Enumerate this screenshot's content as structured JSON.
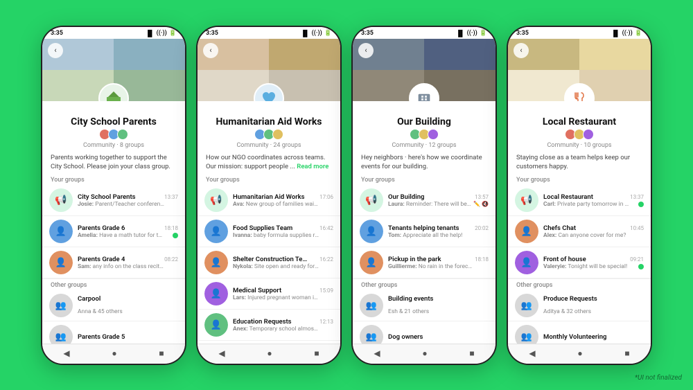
{
  "phones": [
    {
      "id": "phone1",
      "status_time": "3:35",
      "community_name": "City School Parents",
      "community_meta": "Community · 8 groups",
      "community_desc": "Parents working together to support the City School. Please join your class group.",
      "community_icon_type": "school",
      "avatar_colors": [
        "av1",
        "av2",
        "av3"
      ],
      "your_groups_label": "Your groups",
      "groups": [
        {
          "name": "City School Parents",
          "preview_sender": "Josie:",
          "preview": "Parent/Teacher conferences ...",
          "time": "13:37",
          "has_dot": false,
          "avatar_type": "megaphone",
          "avatar_color": "green"
        },
        {
          "name": "Parents Grade 6",
          "preview_sender": "Amelia:",
          "preview": "Have a math tutor for the upc...",
          "time": "18:18",
          "has_dot": true,
          "avatar_type": "person",
          "avatar_color": "blue"
        },
        {
          "name": "Parents Grade 4",
          "preview_sender": "Sam:",
          "preview": "any info on the class recital?",
          "time": "08:22",
          "has_dot": false,
          "avatar_type": "person",
          "avatar_color": "orange"
        }
      ],
      "other_groups_label": "Other groups",
      "other_groups": [
        {
          "name": "Carpool",
          "meta": "Anna & 45 others",
          "avatar_color": "grey"
        },
        {
          "name": "Parents Grade 5",
          "meta": "",
          "avatar_color": "grey"
        }
      ]
    },
    {
      "id": "phone2",
      "status_time": "3:35",
      "community_name": "Humanitarian Aid Works",
      "community_meta": "Community · 24 groups",
      "community_desc": "How our NGO coordinates across teams. Our mission: support people ...",
      "community_desc_read_more": "Read more",
      "community_icon_type": "heart",
      "avatar_colors": [
        "av2",
        "av3",
        "av4"
      ],
      "your_groups_label": "Your groups",
      "groups": [
        {
          "name": "Humanitarian Aid Works",
          "preview_sender": "Ava:",
          "preview": "New group of families waiting ...",
          "time": "17:06",
          "has_dot": false,
          "avatar_type": "megaphone",
          "avatar_color": "green"
        },
        {
          "name": "Food Supplies Team",
          "preview_sender": "Ivanna:",
          "preview": "baby formula supplies running ...",
          "time": "16:42",
          "has_dot": false,
          "avatar_type": "person",
          "avatar_color": "blue"
        },
        {
          "name": "Shelter Construction Team",
          "preview_sender": "Nykola:",
          "preview": "Site open and ready for ...",
          "time": "16:22",
          "has_dot": false,
          "avatar_type": "person",
          "avatar_color": "orange"
        },
        {
          "name": "Medical Support",
          "preview_sender": "Lars:",
          "preview": "Injured pregnant woman in need ...",
          "time": "15:09",
          "has_dot": false,
          "avatar_type": "person",
          "avatar_color": "purple"
        },
        {
          "name": "Education Requests",
          "preview_sender": "Anex:",
          "preview": "Temporary school almost comp...",
          "time": "12:13",
          "has_dot": false,
          "avatar_type": "person",
          "avatar_color": "green"
        }
      ],
      "other_groups_label": "",
      "other_groups": []
    },
    {
      "id": "phone3",
      "status_time": "3:35",
      "community_name": "Our Building",
      "community_meta": "Community · 12 groups",
      "community_desc": "Hey neighbors · here's how we coordinate events for our building.",
      "community_icon_type": "building",
      "avatar_colors": [
        "av3",
        "av4",
        "av5"
      ],
      "your_groups_label": "Your groups",
      "groups": [
        {
          "name": "Our Building",
          "preview_sender": "Laura:",
          "preview": "Reminder: There will be ...",
          "time": "13:57",
          "has_dot": false,
          "has_pencil": true,
          "has_mute": true,
          "avatar_type": "megaphone",
          "avatar_color": "green"
        },
        {
          "name": "Tenants helping tenants",
          "preview_sender": "Tom:",
          "preview": "Appreciate all the help!",
          "time": "20:02",
          "has_dot": false,
          "avatar_type": "person",
          "avatar_color": "blue"
        },
        {
          "name": "Pickup in the park",
          "preview_sender": "Guillierme:",
          "preview": "No rain in the forecast!",
          "time": "18:18",
          "has_dot": false,
          "avatar_type": "person",
          "avatar_color": "orange"
        }
      ],
      "other_groups_label": "Other groups",
      "other_groups": [
        {
          "name": "Building events",
          "meta": "Esh & 21 others",
          "avatar_color": "grey"
        },
        {
          "name": "Dog owners",
          "meta": "",
          "avatar_color": "grey"
        }
      ]
    },
    {
      "id": "phone4",
      "status_time": "3:35",
      "community_name": "Local Restaurant",
      "community_meta": "Community · 10 groups",
      "community_desc": "Staying close as a team helps keep our customers happy.",
      "community_icon_type": "fork",
      "avatar_colors": [
        "av1",
        "av4",
        "av5"
      ],
      "your_groups_label": "Your groups",
      "groups": [
        {
          "name": "Local Restaurant",
          "preview_sender": "Carl:",
          "preview": "Private party tomorrow in the ...",
          "time": "13:37",
          "has_dot": true,
          "avatar_type": "megaphone",
          "avatar_color": "green"
        },
        {
          "name": "Chefs Chat",
          "preview_sender": "Alex:",
          "preview": "Can anyone cover for me?",
          "time": "10:45",
          "has_dot": false,
          "avatar_type": "person",
          "avatar_color": "orange"
        },
        {
          "name": "Front of house",
          "preview_sender": "Valeryie:",
          "preview": "Tonight will be special!",
          "time": "09:21",
          "has_dot": true,
          "avatar_type": "person",
          "avatar_color": "purple"
        }
      ],
      "other_groups_label": "Other groups",
      "other_groups": [
        {
          "name": "Produce Requests",
          "meta": "Aditya & 32 others",
          "avatar_color": "grey"
        },
        {
          "name": "Monthly Volunteering",
          "meta": "",
          "avatar_color": "grey"
        }
      ]
    }
  ],
  "disclaimer": "*UI not finalized",
  "nav": {
    "back_icon": "◀",
    "home_icon": "●",
    "square_icon": "■"
  }
}
